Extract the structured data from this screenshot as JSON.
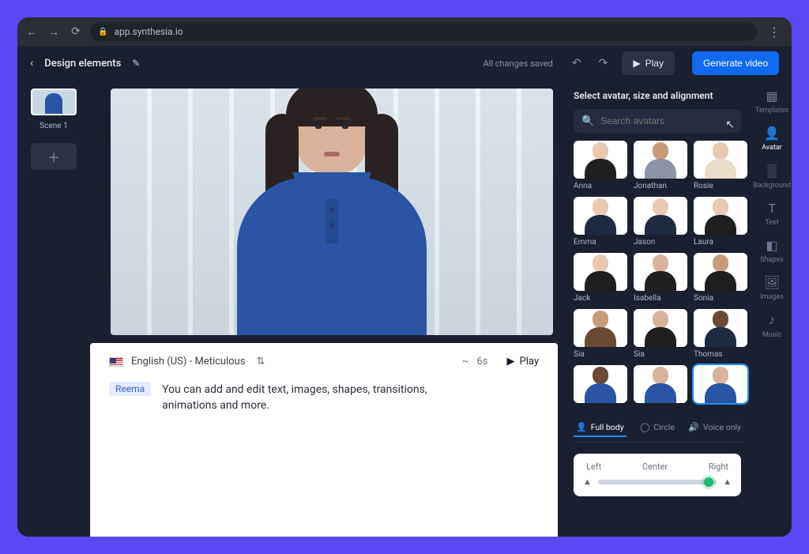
{
  "browser": {
    "url": "app.synthesia.io"
  },
  "header": {
    "title": "Design elements",
    "save_status": "All changes saved",
    "play": "Play",
    "generate": "Generate video"
  },
  "scenes": {
    "items": [
      {
        "label": "Scene 1"
      }
    ]
  },
  "script": {
    "language": "English (US) - Meticulous",
    "duration_prefix": "~",
    "duration": "6s",
    "play": "Play",
    "speaker": "Reema",
    "text": "You can add and edit text, images, shapes, transitions, animations and more."
  },
  "rightPanel": {
    "title": "Select avatar, size and alignment",
    "search_placeholder": "Search avatars",
    "avatars": [
      {
        "name": "Anna",
        "skin": "skin-light",
        "top": "top-black"
      },
      {
        "name": "Jonathan",
        "skin": "skin-tan",
        "top": "top-grey"
      },
      {
        "name": "Rosie",
        "skin": "skin-light",
        "top": "top-cream"
      },
      {
        "name": "Emma",
        "skin": "skin-light",
        "top": "top-navy"
      },
      {
        "name": "Jason",
        "skin": "skin-light",
        "top": "top-navy"
      },
      {
        "name": "Laura",
        "skin": "skin-light",
        "top": "top-black"
      },
      {
        "name": "Jack",
        "skin": "skin-light",
        "top": "top-black"
      },
      {
        "name": "Isabella",
        "skin": "skin-med",
        "top": "top-black"
      },
      {
        "name": "Sonia",
        "skin": "skin-tan",
        "top": "top-black"
      },
      {
        "name": "Sia",
        "skin": "skin-tan",
        "top": "top-brown"
      },
      {
        "name": "Sia",
        "skin": "skin-med",
        "top": "top-black"
      },
      {
        "name": "Thomas",
        "skin": "skin-dark",
        "top": "top-navy"
      },
      {
        "name": "",
        "skin": "skin-dark",
        "top": "top-blue"
      },
      {
        "name": "",
        "skin": "skin-med",
        "top": "top-blue"
      },
      {
        "name": "",
        "skin": "skin-med",
        "top": "top-blue",
        "selected": true
      }
    ],
    "view_tabs": {
      "full": "Full body",
      "circle": "Circle",
      "voice": "Voice only"
    },
    "align": {
      "left": "Left",
      "center": "Center",
      "right": "Right"
    }
  },
  "rightTabs": {
    "templates": "Templates",
    "avatar": "Avatar",
    "background": "Background",
    "text": "Text",
    "shapes": "Shapes",
    "images": "Images",
    "music": "Music"
  }
}
